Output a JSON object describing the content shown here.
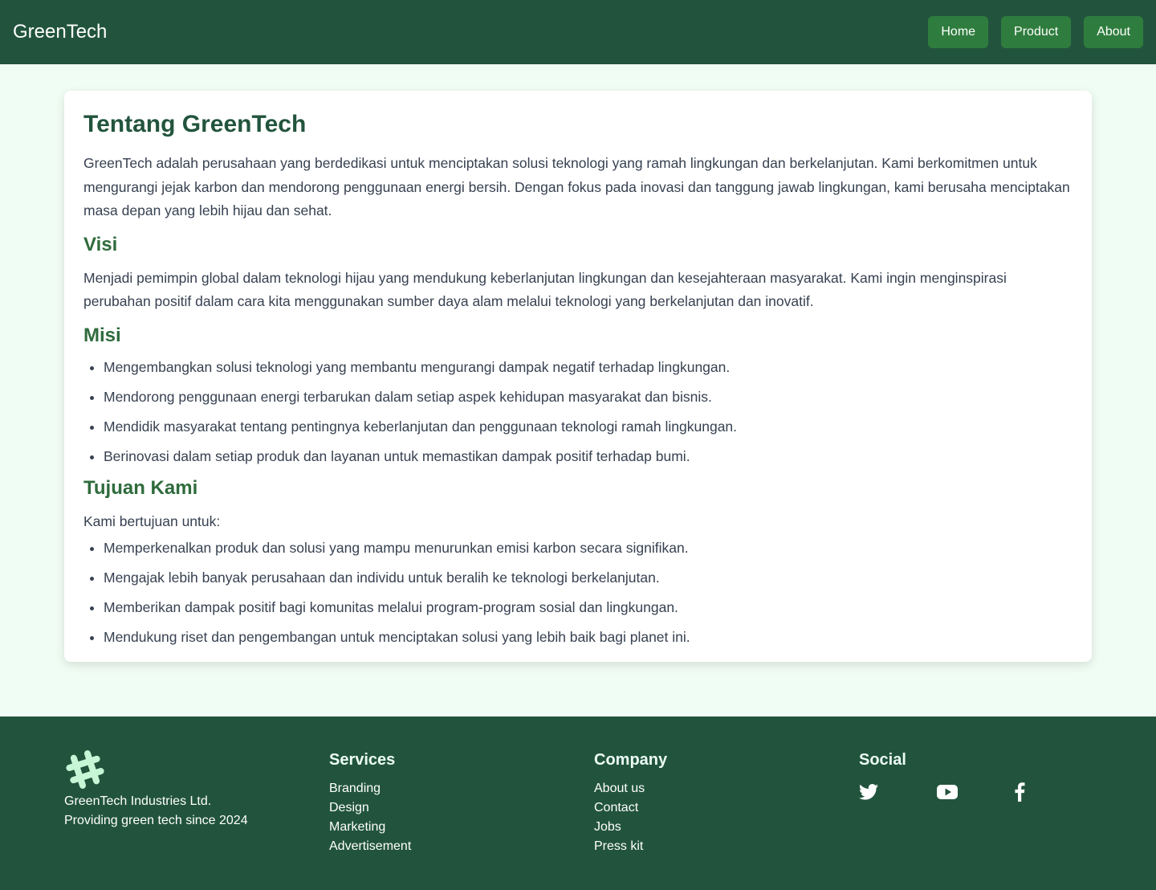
{
  "navbar": {
    "brand": "GreenTech",
    "links": [
      {
        "label": "Home"
      },
      {
        "label": "Product"
      },
      {
        "label": "About"
      }
    ]
  },
  "about": {
    "title": "Tentang GreenTech",
    "intro": "GreenTech adalah perusahaan yang berdedikasi untuk menciptakan solusi teknologi yang ramah lingkungan dan berkelanjutan. Kami berkomitmen untuk mengurangi jejak karbon dan mendorong penggunaan energi bersih. Dengan fokus pada inovasi dan tanggung jawab lingkungan, kami berusaha menciptakan masa depan yang lebih hijau dan sehat.",
    "vision": {
      "heading": "Visi",
      "text": "Menjadi pemimpin global dalam teknologi hijau yang mendukung keberlanjutan lingkungan dan kesejahteraan masyarakat. Kami ingin menginspirasi perubahan positif dalam cara kita menggunakan sumber daya alam melalui teknologi yang berkelanjutan dan inovatif."
    },
    "mission": {
      "heading": "Misi",
      "items": [
        "Mengembangkan solusi teknologi yang membantu mengurangi dampak negatif terhadap lingkungan.",
        "Mendorong penggunaan energi terbarukan dalam setiap aspek kehidupan masyarakat dan bisnis.",
        "Mendidik masyarakat tentang pentingnya keberlanjutan dan penggunaan teknologi ramah lingkungan.",
        "Berinovasi dalam setiap produk dan layanan untuk memastikan dampak positif terhadap bumi."
      ]
    },
    "goals": {
      "heading": "Tujuan Kami",
      "lead": "Kami bertujuan untuk:",
      "items": [
        "Memperkenalkan produk dan solusi yang mampu menurunkan emisi karbon secara signifikan.",
        "Mengajak lebih banyak perusahaan dan individu untuk beralih ke teknologi berkelanjutan.",
        "Memberikan dampak positif bagi komunitas melalui program-program sosial dan lingkungan.",
        "Mendukung riset dan pengembangan untuk menciptakan solusi yang lebih baik bagi planet ini."
      ]
    }
  },
  "footer": {
    "logo_icon": "hash-icon",
    "company_name": "GreenTech Industries Ltd.",
    "tagline": "Providing green tech since 2024",
    "services": {
      "heading": "Services",
      "links": [
        "Branding",
        "Design",
        "Marketing",
        "Advertisement"
      ]
    },
    "company": {
      "heading": "Company",
      "links": [
        "About us",
        "Contact",
        "Jobs",
        "Press kit"
      ]
    },
    "social": {
      "heading": "Social",
      "icons": [
        "twitter-icon",
        "youtube-icon",
        "facebook-icon"
      ]
    }
  },
  "colors": {
    "nav_bg": "#22543d",
    "nav_button": "#2f7d3e",
    "page_bg": "#f0fdf4",
    "heading": "#22543d",
    "subheading": "#2f6b3c",
    "logo": "#c6f6d5"
  }
}
